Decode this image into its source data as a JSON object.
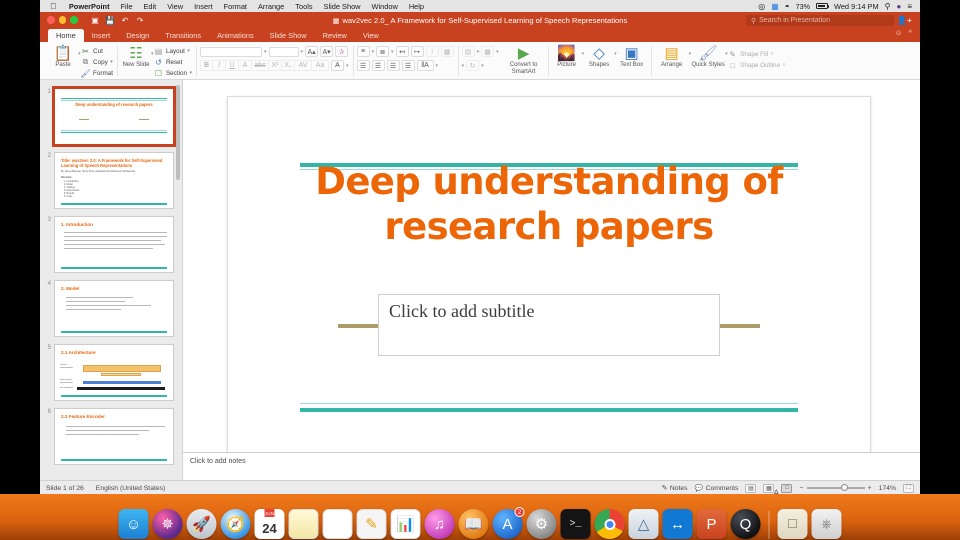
{
  "macbar": {
    "apple": "",
    "app": "PowerPoint",
    "menus": [
      "File",
      "Edit",
      "View",
      "Insert",
      "Format",
      "Arrange",
      "Tools",
      "Slide Show",
      "Window",
      "Help"
    ],
    "battery": "73%",
    "clock": "Wed 9:14 PM",
    "icons": [
      "airplay-icon",
      "displays-icon",
      "wifi-icon",
      "battery-icon",
      "spotlight-icon",
      "siri-icon",
      "notification-center-icon"
    ]
  },
  "window": {
    "doc_title": "wav2vec 2.0_ A Framework for Self-Supervised Learning of Speech Representations",
    "quick_access": [
      "new-icon",
      "save-icon",
      "undo-icon",
      "redo-icon"
    ],
    "search_placeholder": "Search in Presentation",
    "share_icon": "share-person-icon",
    "emoji_icon": "smiley-icon",
    "collapse_icon": "chevron-up-icon"
  },
  "ribbon": {
    "tabs": [
      "Home",
      "Insert",
      "Design",
      "Transitions",
      "Animations",
      "Slide Show",
      "Review",
      "View"
    ],
    "active_tab": "Home",
    "clipboard": {
      "paste": "Paste",
      "cut": "Cut",
      "copy": "Copy",
      "format": "Format"
    },
    "slides": {
      "new_slide": "New Slide",
      "layout": "Layout",
      "reset": "Reset",
      "section": "Section"
    },
    "font": {
      "name": "",
      "size": "",
      "grow": "A",
      "shrink": "A",
      "clear_format": "clear-formatting-icon",
      "bold": "B",
      "italic": "I",
      "underline": "U",
      "shadow": "A",
      "strike": "abc",
      "superscript": "X²",
      "subscript": "X₂",
      "spacing": "AV",
      "case": "Aa",
      "color": "A"
    },
    "drawing": {
      "convert": "Convert to SmartArt",
      "picture": "Picture",
      "shapes": "Shapes",
      "textbox": "Text Box",
      "arrange": "Arrange",
      "quick_styles": "Quick Styles",
      "shape_fill": "Shape Fill",
      "shape_outline": "Shape Outline"
    }
  },
  "slide_panel": {
    "thumbnails": [
      {
        "number": "1",
        "selected": true,
        "title": "Deep understanding of research papers",
        "kind": "title"
      },
      {
        "number": "2",
        "selected": false,
        "title": "Title: wav2vec 2.0: A Framework for Self-Supervised Learning of Speech Representations",
        "byline": "By: Alexei Baevski, Henry Zhou, Abdelrahman Mohamed, Michael Auli",
        "section": "Structure",
        "bullets": [
          "1. Introduction",
          "2. Model",
          "3. Training",
          "4. Experiments",
          "5. Results",
          "6. Code"
        ],
        "kind": "content"
      },
      {
        "number": "3",
        "selected": false,
        "title": "1. Introduction",
        "kind": "content"
      },
      {
        "number": "4",
        "selected": false,
        "title": "2. Model",
        "kind": "content"
      },
      {
        "number": "5",
        "selected": false,
        "title": "2.1 Architecture",
        "kind": "figure"
      },
      {
        "number": "6",
        "selected": false,
        "title": "2.2 Feature Encoder",
        "kind": "content"
      }
    ]
  },
  "slide": {
    "title": "Deep understanding of research papers",
    "subtitle_placeholder": "Click to add subtitle",
    "accent_teal": "#35b4a8",
    "accent_orange": "#ec6608",
    "accent_gold": "#ab9c6a"
  },
  "notes": {
    "placeholder": "Click to add notes"
  },
  "status": {
    "slide_counter": "Slide 1 of 26",
    "language": "English (United States)",
    "notes_button": "Notes",
    "comments_button": "Comments",
    "zoom_level": "174%",
    "view_normal_icon": "normal-view-icon",
    "view_sorter_icon": "slide-sorter-icon",
    "view_reading_icon": "reading-view-icon",
    "fit_icon": "fit-to-window-icon",
    "zoom_out": "−",
    "zoom_in": "+"
  },
  "dock": {
    "calendar_month": "JUN",
    "calendar_day": "24",
    "appstore_badge": "2",
    "items": [
      {
        "name": "finder",
        "glyph": "☺",
        "bg": "#2e9ae6",
        "shape": "rounded",
        "running": true
      },
      {
        "name": "siri",
        "glyph": "✹",
        "bg": "#2b1b3d",
        "shape": "circle",
        "running": false
      },
      {
        "name": "launchpad",
        "glyph": "🚀",
        "bg": "#cfd4d9",
        "shape": "circle",
        "running": false
      },
      {
        "name": "safari",
        "glyph": "🧭",
        "bg": "#3ba7ef",
        "shape": "circle",
        "running": false
      },
      {
        "name": "calendar",
        "glyph": "",
        "bg": "#ffffff",
        "shape": "rounded",
        "running": false
      },
      {
        "name": "notes",
        "glyph": "",
        "bg": "#fdf6d8",
        "shape": "rounded",
        "running": false
      },
      {
        "name": "reminders",
        "glyph": "",
        "bg": "#ffffff",
        "shape": "rounded",
        "running": false
      },
      {
        "name": "pages",
        "glyph": "✎",
        "bg": "#f2f2f2",
        "shape": "rounded",
        "running": false
      },
      {
        "name": "numbers",
        "glyph": "📊",
        "bg": "#ffffff",
        "shape": "rounded",
        "running": false
      },
      {
        "name": "itunes",
        "glyph": "♫",
        "bg": "#e46ad4",
        "shape": "circle",
        "running": false
      },
      {
        "name": "ibooks",
        "glyph": "📖",
        "bg": "#f0962a",
        "shape": "circle",
        "running": false
      },
      {
        "name": "appstore",
        "glyph": "A",
        "bg": "#2b8cf0",
        "shape": "circle",
        "running": false
      },
      {
        "name": "system-preferences",
        "glyph": "⚙",
        "bg": "#9a9a9a",
        "shape": "circle",
        "running": false
      },
      {
        "name": "terminal",
        "glyph": ">_",
        "bg": "#1a1a1a",
        "shape": "rounded",
        "running": false
      },
      {
        "name": "chrome",
        "glyph": "◉",
        "bg": "#ffffff",
        "shape": "circle",
        "running": true
      },
      {
        "name": "xcode",
        "glyph": "A",
        "bg": "#dfe4ea",
        "shape": "rounded",
        "running": false
      },
      {
        "name": "teamviewer",
        "glyph": "↔",
        "bg": "#1b7ae0",
        "shape": "rounded",
        "running": true
      },
      {
        "name": "powerpoint",
        "glyph": "P",
        "bg": "#c8421f",
        "shape": "rounded",
        "running": true
      },
      {
        "name": "quicktime",
        "glyph": "Q",
        "bg": "#15161a",
        "shape": "circle",
        "running": true
      },
      {
        "name": "downloads-folder",
        "glyph": "🗂",
        "bg": "#e8e4d8",
        "shape": "rounded",
        "running": false
      },
      {
        "name": "trash",
        "glyph": "🗑",
        "bg": "#e9e9e9",
        "shape": "rounded",
        "running": false
      }
    ]
  }
}
